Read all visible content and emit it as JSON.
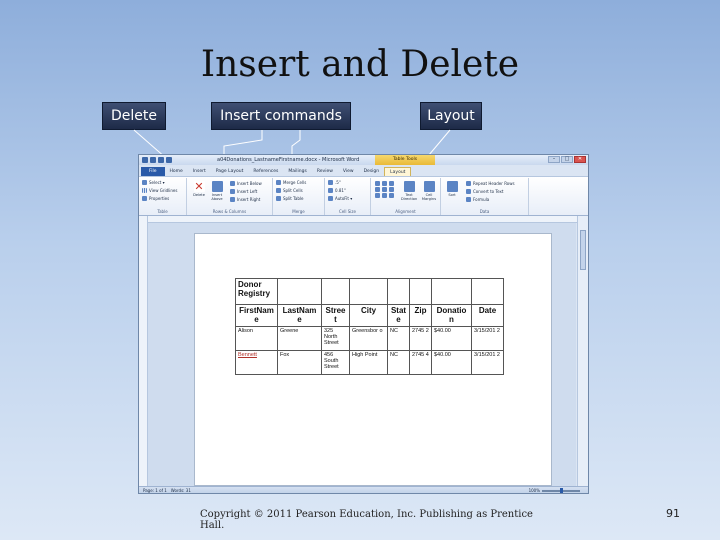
{
  "slide": {
    "title": "Insert and Delete",
    "callouts": {
      "delete": "Delete",
      "insert": "Insert commands",
      "layout": "Layout"
    },
    "footer": "Copyright © 2011 Pearson Education, Inc. Publishing as Prentice Hall.",
    "page_number": "91"
  },
  "word": {
    "title": "a04Donations_LastnameFirstname.docx - Microsoft Word",
    "context_tab": "Table Tools",
    "window_buttons": [
      "–",
      "□",
      "✕"
    ],
    "tabs": [
      "File",
      "Home",
      "Insert",
      "Page Layout",
      "References",
      "Mailings",
      "Review",
      "View",
      "Design",
      "Layout"
    ],
    "ribbon": {
      "table_group": {
        "label": "Table",
        "items": [
          "Select ▾",
          "View Gridlines",
          "Properties"
        ]
      },
      "rows_group": {
        "label": "Rows & Columns",
        "delete": "Delete",
        "insert_above": "Insert Above",
        "items": [
          "Insert Below",
          "Insert Left",
          "Insert Right"
        ]
      },
      "merge_group": {
        "label": "Merge",
        "items": [
          "Merge Cells",
          "Split Cells",
          "Split Table"
        ]
      },
      "cellsize_group": {
        "label": "Cell Size",
        "items": [
          ".5\"",
          "0.81\"",
          "AutoFit ▾"
        ]
      },
      "alignment_group": {
        "label": "Alignment",
        "direction": "Text Direction",
        "margins": "Cell Margins"
      },
      "data_group": {
        "label": "Data",
        "sort": "Sort",
        "items": [
          "Repeat Header Rows",
          "Convert to Text",
          "Formula"
        ]
      }
    },
    "status": {
      "page": "Page: 1 of 1",
      "words": "Words: 31",
      "zoom": "100%"
    },
    "table": {
      "title": "Donor Registry",
      "headers": [
        "FirstNam e",
        "LastNam e",
        "Stree t",
        "City",
        "Stat e",
        "Zip",
        "Donatio n",
        "Date"
      ],
      "rows": [
        [
          "Alison",
          "Greene",
          "325 North Street",
          "Greensbor o",
          "NC",
          "2745 2",
          "$40.00",
          "3/15/201 2"
        ],
        [
          "Bennett",
          "Fox",
          "456 South Street",
          "High Point",
          "NC",
          "2745 4",
          "$40.00",
          "3/15/201 2"
        ]
      ]
    }
  }
}
